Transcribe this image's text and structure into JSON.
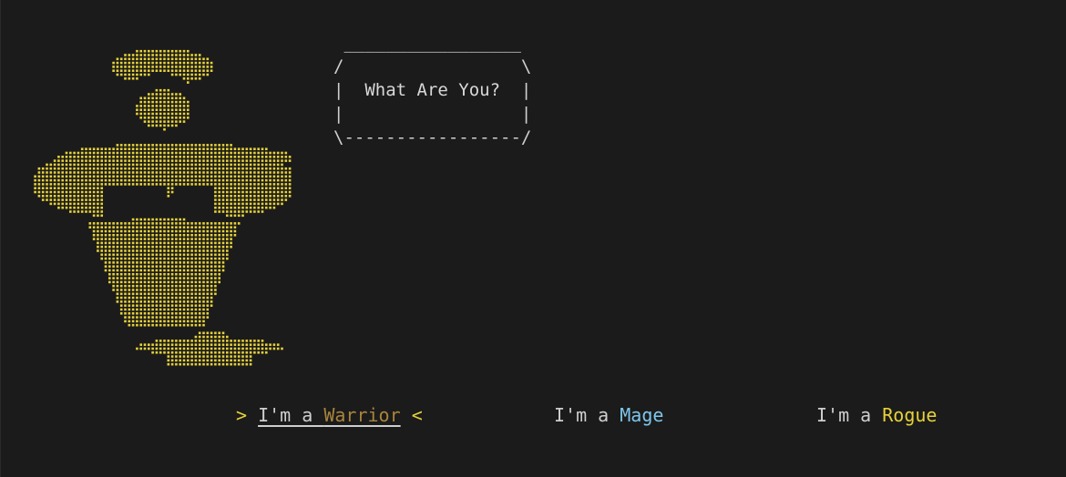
{
  "speech_box": {
    "top": " _________________",
    "upper": "/                 \\",
    "title": "What Are You?",
    "title_prefix": "|  ",
    "title_suffix": "  |",
    "blank": "|                 |",
    "bottom": "\\-----------------/"
  },
  "choices": [
    {
      "prefix": "I'm a ",
      "name": "Warrior",
      "color": "#a8853c",
      "selected": true
    },
    {
      "prefix": "I'm a ",
      "name": "Mage",
      "color": "#7fc6ec",
      "selected": false
    },
    {
      "prefix": "I'm a ",
      "name": "Rogue",
      "color": "#e6d13a",
      "selected": false
    }
  ],
  "selection_markers": {
    "left": ">",
    "right": "<"
  },
  "colors": {
    "background": "#1b1b1b",
    "text": "#cfcfcf",
    "art": "#e6d13a"
  },
  "art": {
    "name": "genie-lamp-dot-art"
  }
}
